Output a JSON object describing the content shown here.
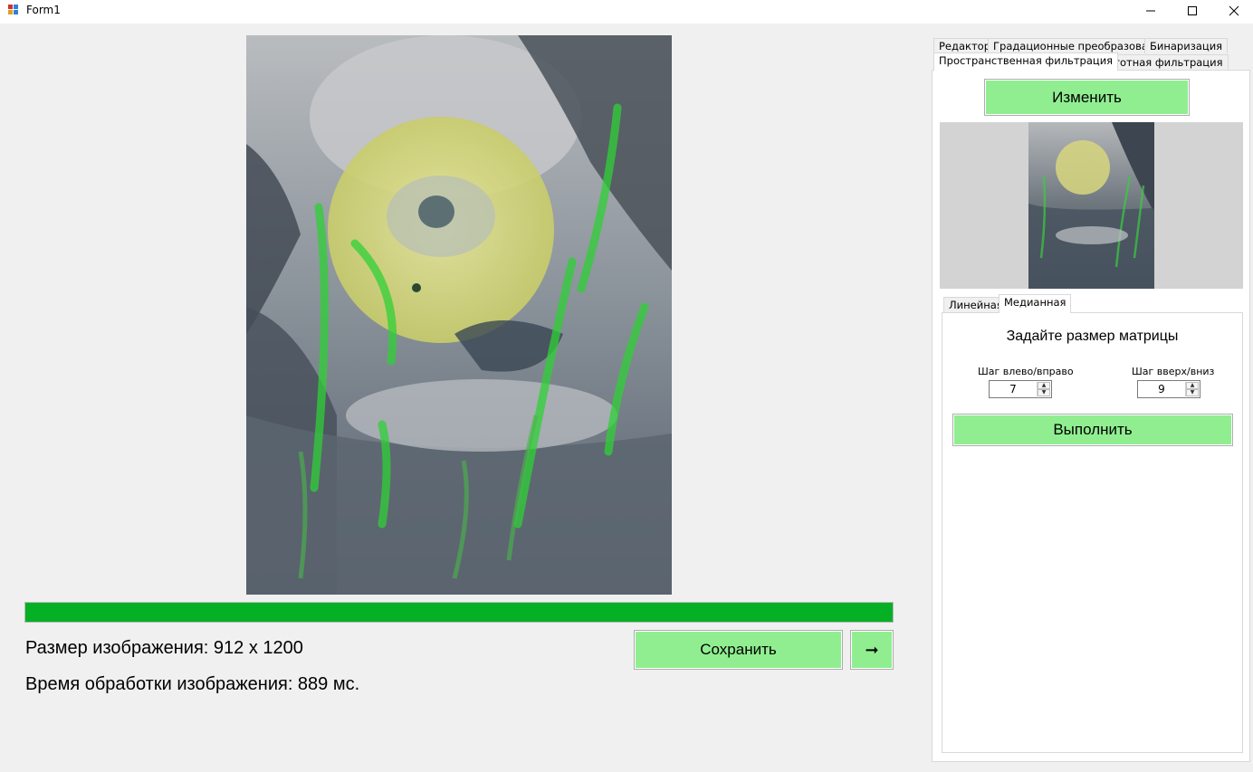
{
  "window": {
    "title": "Form1"
  },
  "main": {
    "progress_percent": 100,
    "size_label": "Размер изображения: 912 x 1200",
    "time_label": "Время обработки изображения: 889 мс.",
    "save_label": "Сохранить",
    "next_label": "➞"
  },
  "tabs": [
    {
      "label": "Редактор"
    },
    {
      "label": "Градационные преобразования"
    },
    {
      "label": "Бинаризация"
    },
    {
      "label": "Пространственная фильтрация",
      "active": true
    },
    {
      "label": "Частотная фильтрация"
    }
  ],
  "panel": {
    "change_label": "Изменить",
    "subtabs": [
      {
        "label": "Линейная"
      },
      {
        "label": "Медианная",
        "active": true
      }
    ],
    "heading": "Задайте размер матрицы",
    "step_lr_label": "Шаг влево/вправо",
    "step_ud_label": "Шаг вверх/вниз",
    "step_lr_value": "7",
    "step_ud_value": "9",
    "run_label": "Выполнить"
  },
  "colors": {
    "accent_button": "#90ee90",
    "progress": "#06b025"
  },
  "icons": {
    "app": "app-icon",
    "minimize": "minimize-icon",
    "maximize": "maximize-icon",
    "close": "close-icon",
    "arrow": "arrow-right-icon"
  }
}
